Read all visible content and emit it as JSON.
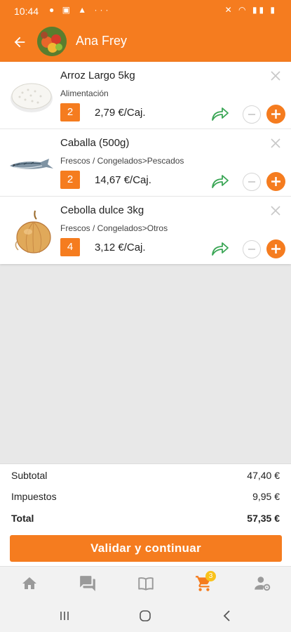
{
  "status_bar": {
    "time": "10:44",
    "left_icons": "● ▣ ▲ ···",
    "right_icons": "✕ ◠ ▮▮ ▮"
  },
  "header": {
    "title": "Ana Frey",
    "back_icon": "arrow-left-icon",
    "avatar_icon": "avatar"
  },
  "cart_items": [
    {
      "name": "Arroz Largo 5kg",
      "category": "Alimentación",
      "quantity": "2",
      "price": "2,79 €/Caj."
    },
    {
      "name": "Caballa (500g)",
      "category": "Frescos / Congelados>Pescados",
      "quantity": "2",
      "price": "14,67 €/Caj."
    },
    {
      "name": "Cebolla dulce 3kg",
      "category": "Frescos / Congelados>Otros",
      "quantity": "4",
      "price": "3,12 €/Caj."
    }
  ],
  "summary": {
    "subtotal_label": "Subtotal",
    "subtotal_value": "47,40 €",
    "tax_label": "Impuestos",
    "tax_value": "9,95 €",
    "total_label": "Total",
    "total_value": "57,35 €"
  },
  "validate_button": "Validar y continuar",
  "bottom_nav": {
    "items": [
      "home-icon",
      "chat-icon",
      "catalog-icon",
      "cart-icon",
      "account-icon"
    ],
    "cart_badge": "3",
    "active": "cart-icon"
  },
  "colors": {
    "accent": "#f57c1f",
    "share_green": "#3aa655",
    "badge": "#f9c21b",
    "inactive_icon": "#9a9a9a"
  }
}
